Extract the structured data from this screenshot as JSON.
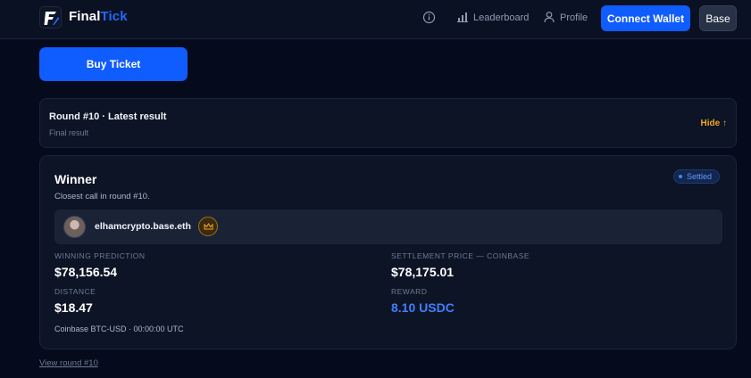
{
  "nav": {
    "brand_main": "Final",
    "brand_accent": "Tick",
    "logo_text": "F",
    "leaderboard": "Leaderboard",
    "profile": "Profile",
    "connect_wallet": "Connect Wallet",
    "network": "Base"
  },
  "buy_ticket": "Buy Ticket",
  "round": {
    "title": "Round #10 · Latest result",
    "subtitle": "Final result",
    "toggle": "Hide ↑"
  },
  "winner": {
    "title": "Winner",
    "subtitle": "Closest call in round #10.",
    "status": "Settled",
    "username": "elhamcrypto.base.eth",
    "stats": {
      "winning_prediction_label": "WINNING PREDICTION",
      "winning_prediction": "$78,156.54",
      "settlement_label": "SETTLEMENT PRICE — COINBASE",
      "settlement": "$78,175.01",
      "distance_label": "DISTANCE",
      "distance": "$18.47",
      "reward_label": "REWARD",
      "reward": "8.10 USDC"
    },
    "footnote": "Coinbase BTC-USD · 00:00:00 UTC"
  },
  "view_round": "View round #10",
  "colors": {
    "accent": "#0f5cff",
    "warning": "#f5a623",
    "background": "#050b1c"
  }
}
